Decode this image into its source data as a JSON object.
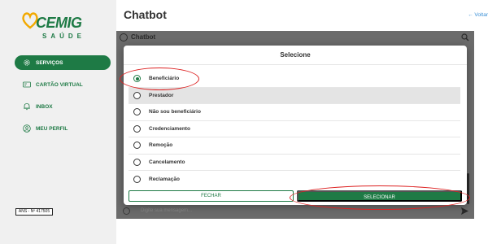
{
  "sidebar": {
    "logo": {
      "brand": "CEMIG",
      "sub": "SAÚDE"
    },
    "items": [
      {
        "label": "SERVIÇOS",
        "icon": "gear-icon",
        "active": true
      },
      {
        "label": "CARTÃO VIRTUAL",
        "icon": "card-icon",
        "active": false
      },
      {
        "label": "INBOX",
        "icon": "bell-icon",
        "active": false
      },
      {
        "label": "MEU PERFIL",
        "icon": "user-icon",
        "active": false
      }
    ],
    "ans_badge": "ANS - Nº 417505"
  },
  "header": {
    "title": "Chatbot",
    "back_label": "← Voltar"
  },
  "chat": {
    "title": "Chatbot",
    "input_placeholder": "Digite sua mensagem..."
  },
  "modal": {
    "title": "Selecione",
    "options": [
      {
        "label": "Beneficiário",
        "selected": true
      },
      {
        "label": "Prestador",
        "selected": false
      },
      {
        "label": "Não sou beneficiário",
        "selected": false
      },
      {
        "label": "Credenciamento",
        "selected": false
      },
      {
        "label": "Remoção",
        "selected": false
      },
      {
        "label": "Cancelamento",
        "selected": false
      },
      {
        "label": "Reclamação",
        "selected": false
      }
    ],
    "close_label": "FECHAR",
    "select_label": "SELECIONAR"
  },
  "colors": {
    "brand_green": "#1e7a45",
    "link_blue": "#3a8fd6",
    "annotation_red": "#dd2222"
  }
}
